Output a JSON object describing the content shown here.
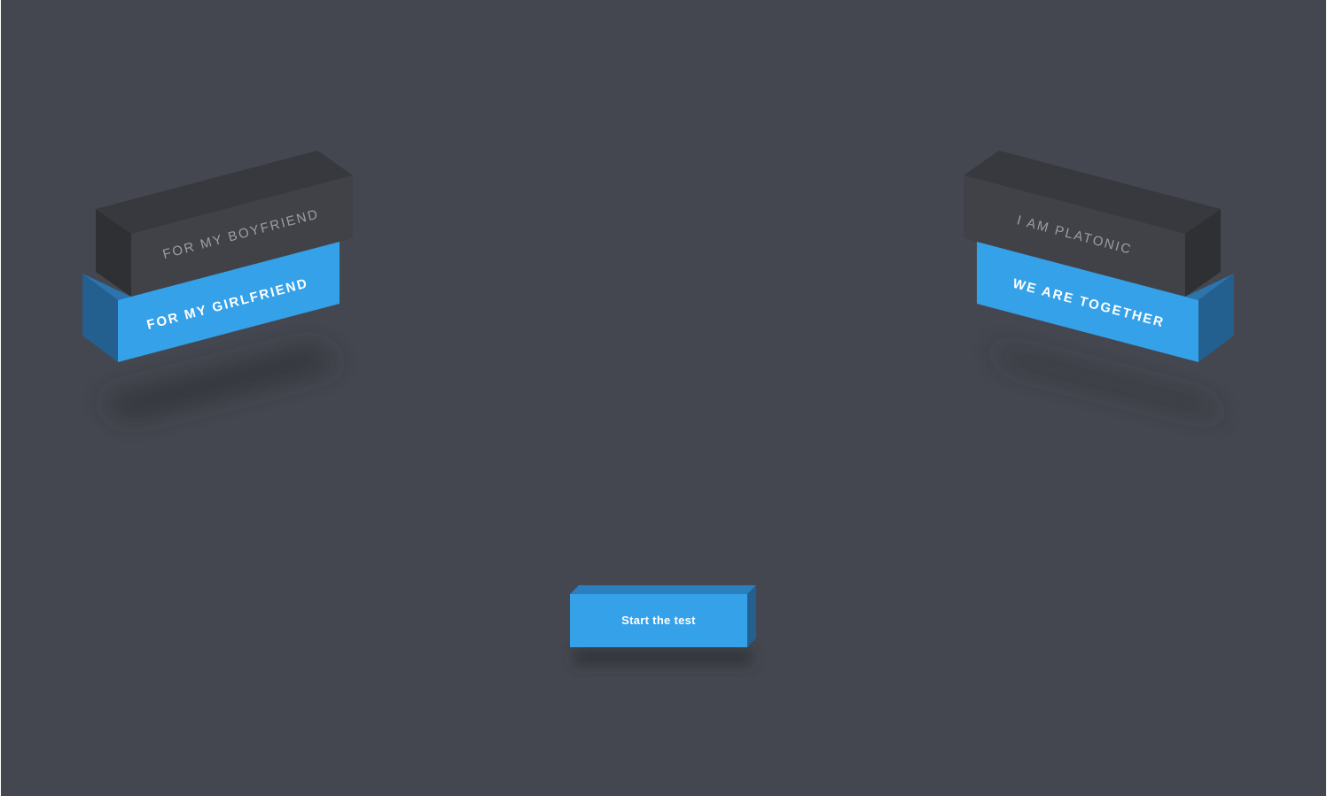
{
  "options": {
    "left_stack": {
      "top_label": "FOR MY BOYFRIEND",
      "bottom_label": "FOR MY GIRLFRIEND"
    },
    "right_stack": {
      "top_label": "I AM PLATONIC",
      "bottom_label": "WE ARE TOGETHER"
    }
  },
  "start_button": {
    "label": "Start the test"
  },
  "colors": {
    "background": "#44474f",
    "accent_blue": "#35a1e9",
    "accent_blue_side": "#235f8f",
    "dark_block_face": "#414248",
    "dark_block_side": "#323437"
  }
}
